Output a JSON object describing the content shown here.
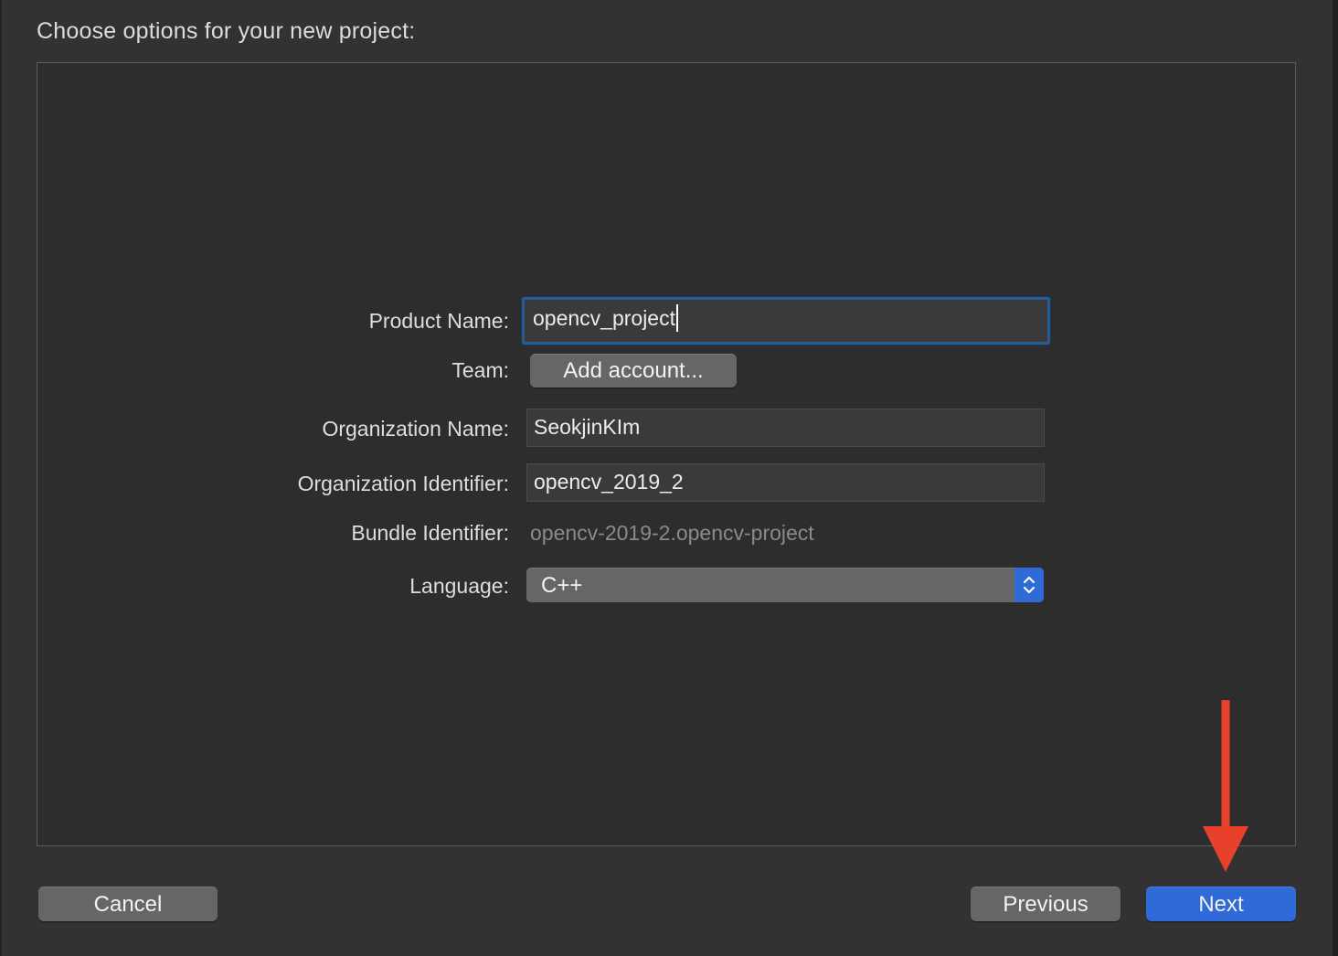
{
  "page": {
    "title": "Choose options for your new project:"
  },
  "form": {
    "product_name": {
      "label": "Product Name:",
      "value": "opencv_project"
    },
    "team": {
      "label": "Team:",
      "button_label": "Add account..."
    },
    "organization_name": {
      "label": "Organization Name:",
      "value": "SeokjinKIm"
    },
    "organization_identifier": {
      "label": "Organization Identifier:",
      "value": "opencv_2019_2"
    },
    "bundle_identifier": {
      "label": "Bundle Identifier:",
      "value": "opencv-2019-2.opencv-project"
    },
    "language": {
      "label": "Language:",
      "value": "C++"
    }
  },
  "footer": {
    "cancel_label": "Cancel",
    "previous_label": "Previous",
    "next_label": "Next"
  },
  "colors": {
    "background": "#323233",
    "accent": "#2f6ad8",
    "annotation_arrow": "#e8412b"
  },
  "icons": [
    "chevron-updown-icon",
    "annotation-arrow-down"
  ]
}
